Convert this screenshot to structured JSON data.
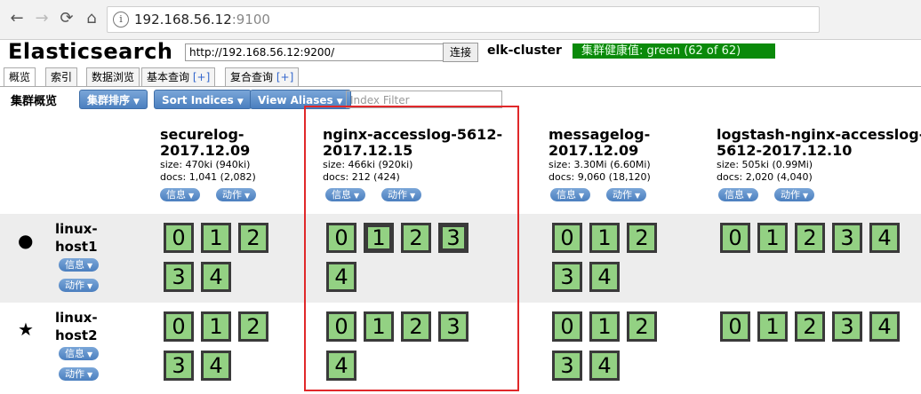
{
  "browser": {
    "back": "←",
    "forward": "→",
    "reload": "⟳",
    "home": "⌂",
    "url_host": "192.168.56.12",
    "url_port": ":9100",
    "info": "i"
  },
  "app": {
    "title": "Elasticsearch",
    "connect_url": "http://192.168.56.12:9200/",
    "connect_label": "连接",
    "cluster_name": "elk-cluster",
    "health": "集群健康值: green (62 of 62)"
  },
  "tabs": [
    {
      "label": "概览"
    },
    {
      "label": "索引"
    },
    {
      "label": "数据浏览"
    },
    {
      "label": "基本查询",
      "plus": "[+]"
    },
    {
      "label": "复合查询",
      "plus": "[+]"
    }
  ],
  "toolbar": {
    "label": "集群概览",
    "sort_cluster": "集群排序",
    "sort_indices": "Sort Indices",
    "view_aliases": "View Aliases",
    "filter_placeholder": "Index Filter"
  },
  "buttons": {
    "info": "信息",
    "action": "动作"
  },
  "indices": [
    {
      "name": "securelog-\n2017.12.09",
      "size": "size: 470ki (940ki)",
      "docs": "docs: 1,041 (2,082)"
    },
    {
      "name": "nginx-accesslog-5612-\n2017.12.15",
      "size": "size: 466ki (920ki)",
      "docs": "docs: 212 (424)"
    },
    {
      "name": "messagelog-\n2017.12.09",
      "size": "size: 3.30Mi (6.60Mi)",
      "docs": "docs: 9,060 (18,120)"
    },
    {
      "name": "logstash-nginx-accesslog-\n5612-2017.12.10",
      "size": "size: 505ki (0.99Mi)",
      "docs": "docs: 2,020 (4,040)"
    }
  ],
  "nodes": [
    {
      "name": "linux-\nhost1",
      "icon": "●"
    },
    {
      "name": "linux-\nhost2",
      "icon": "★"
    }
  ],
  "shards": [
    "0",
    "1",
    "2",
    "3",
    "4"
  ],
  "colors": {
    "health": "#0a8a0a",
    "shard": "#93d183",
    "highlight": "#e0282a"
  }
}
